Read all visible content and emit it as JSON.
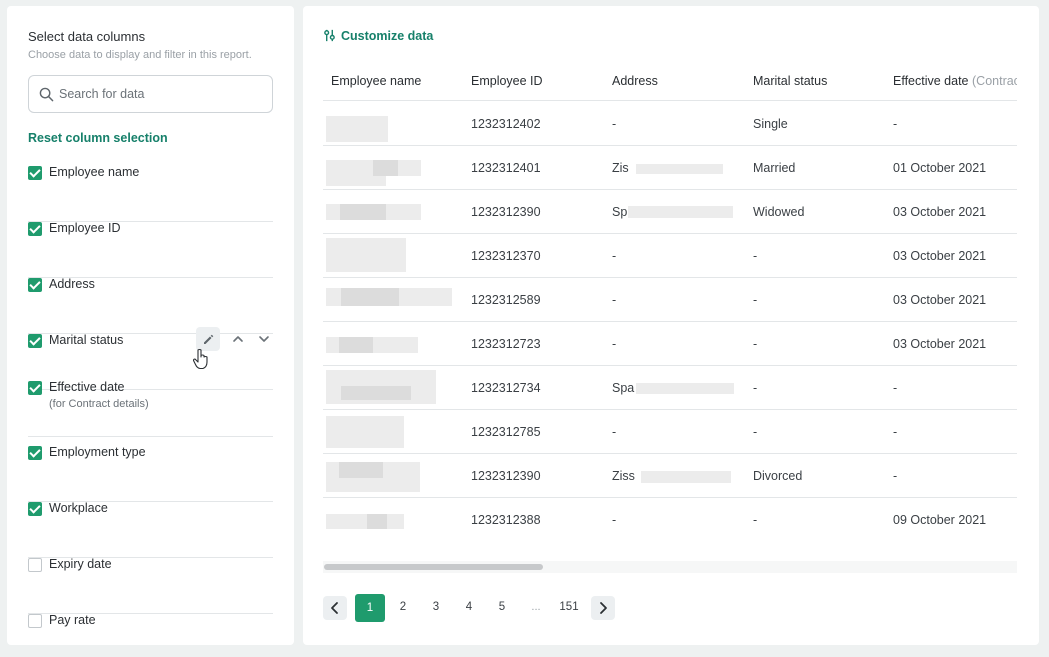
{
  "sidebar": {
    "title": "Select data columns",
    "subtitle": "Choose data to display and filter in this report.",
    "search_placeholder": "Search for data",
    "reset_label": "Reset column selection",
    "columns": [
      {
        "label": "Employee name",
        "checked": true
      },
      {
        "label": "Employee ID",
        "checked": true
      },
      {
        "label": "Address",
        "checked": true
      },
      {
        "label": "Marital status",
        "checked": true
      },
      {
        "label": "Effective date",
        "sublabel": "(for Contract details)",
        "checked": true
      },
      {
        "label": "Employment type",
        "checked": true
      },
      {
        "label": "Workplace",
        "checked": true
      },
      {
        "label": "Expiry date",
        "checked": false
      },
      {
        "label": "Pay rate",
        "checked": false
      }
    ]
  },
  "main": {
    "customize_label": "Customize data",
    "headers": {
      "name": "Employee name",
      "id": "Employee ID",
      "address": "Address",
      "marital": "Marital status",
      "effective": "Effective date",
      "effective_muted": "(Contrac"
    },
    "rows": [
      {
        "id": "1232312402",
        "address": "-",
        "marital": "Single",
        "effective": "-"
      },
      {
        "id": "1232312401",
        "address": "Zis",
        "marital": "Married",
        "effective": "01 October 2021"
      },
      {
        "id": "1232312390",
        "address": "Sp",
        "marital": "Widowed",
        "effective": "03 October 2021"
      },
      {
        "id": "1232312370",
        "address": "-",
        "marital": "-",
        "effective": "03 October 2021"
      },
      {
        "id": "1232312589",
        "address": "-",
        "marital": "-",
        "effective": "03 October 2021"
      },
      {
        "id": "1232312723",
        "address": "-",
        "marital": "-",
        "effective": "03 October 2021"
      },
      {
        "id": "1232312734",
        "address": "Spa",
        "marital": "-",
        "effective": "-"
      },
      {
        "id": "1232312785",
        "address": "-",
        "marital": "-",
        "effective": "-"
      },
      {
        "id": "1232312390",
        "address": "Ziss",
        "marital": "Divorced",
        "effective": "-"
      },
      {
        "id": "1232312388",
        "address": "-",
        "marital": "-",
        "effective": "09 October 2021"
      }
    ]
  },
  "pagination": {
    "current": "1",
    "pages": [
      "2",
      "3",
      "4",
      "5"
    ],
    "ellipsis": "...",
    "last": "151"
  },
  "colors": {
    "accent": "#1f9b6d",
    "link": "#16806a"
  }
}
